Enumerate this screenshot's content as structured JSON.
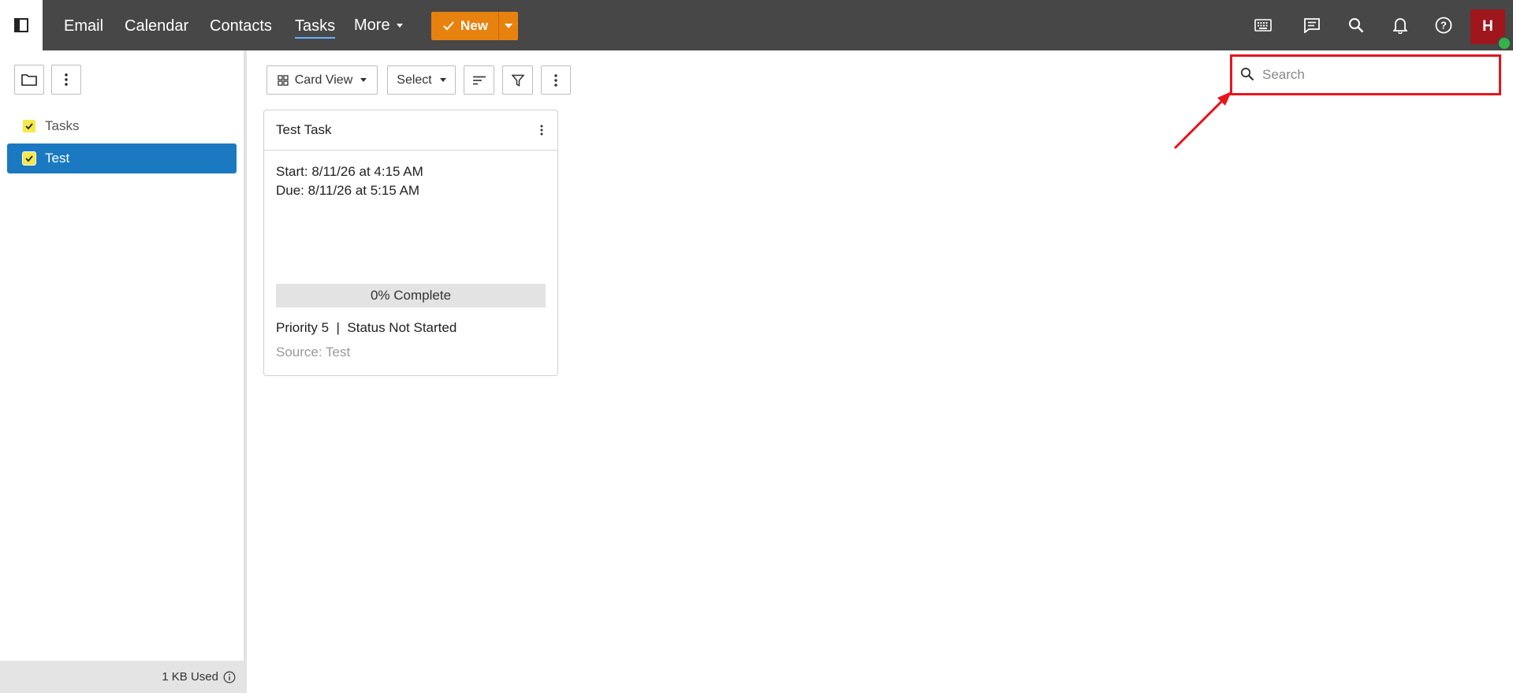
{
  "nav": {
    "items": [
      {
        "label": "Email"
      },
      {
        "label": "Calendar"
      },
      {
        "label": "Contacts"
      },
      {
        "label": "Tasks",
        "active": true
      },
      {
        "label": "More"
      }
    ],
    "new_button": "New",
    "icons": [
      "keyboard-icon",
      "chat-icon",
      "search-icon",
      "bell-icon",
      "help-icon"
    ],
    "avatar_initial": "H",
    "accent": "#e8820f",
    "avatar_color": "#a0161d",
    "presence_color": "#35b34a"
  },
  "sidebar": {
    "folders": [
      {
        "label": "Tasks",
        "selected": false
      },
      {
        "label": "Test",
        "selected": true
      }
    ],
    "storage": "1 KB Used"
  },
  "toolbar": {
    "view_label": "Card View",
    "select_label": "Select"
  },
  "card": {
    "title": "Test Task",
    "start": "Start: 8/11/26 at 4:15 AM",
    "due": "Due: 8/11/26 at 5:15 AM",
    "progress_label": "0% Complete",
    "progress": 0,
    "priority_status": "Priority 5  |  Status Not Started",
    "source": "Source: Test"
  },
  "search": {
    "placeholder": "Search",
    "value": ""
  },
  "annotation": {
    "highlight_color": "#e8141c"
  }
}
